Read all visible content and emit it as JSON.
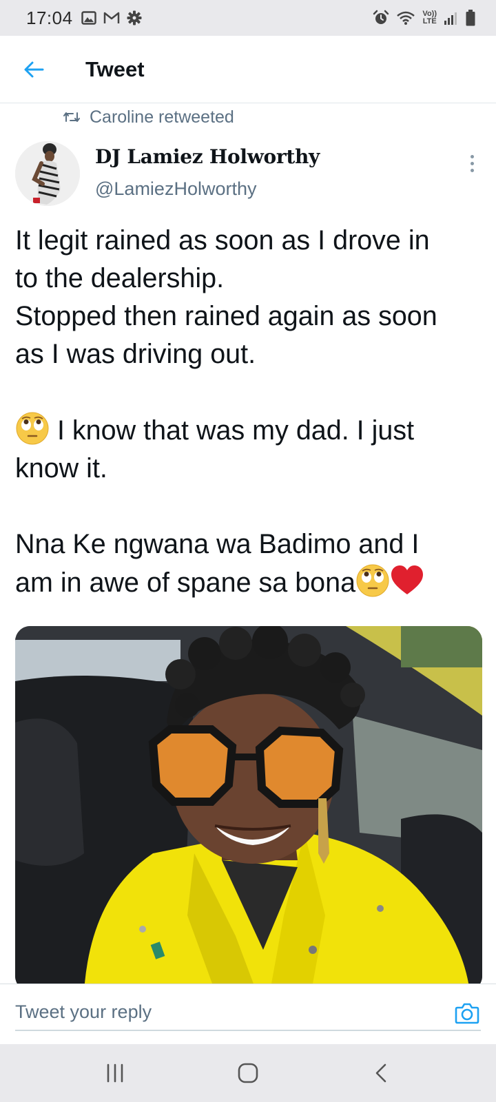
{
  "status_bar": {
    "time": "17:04",
    "left_icons": [
      "gallery-icon",
      "gmail-icon",
      "settings-gear-icon"
    ],
    "right_icons": [
      "alarm-icon",
      "wifi-icon",
      "volte-icon",
      "signal-icon",
      "battery-icon"
    ],
    "volte_label_top": "Vo))",
    "volte_label_bottom": "LTE"
  },
  "app_bar": {
    "back_icon": "arrow-left-icon",
    "title": "Tweet",
    "accent_color": "#1da1f2"
  },
  "tweet": {
    "retweet_icon": "retweet-icon",
    "retweeted_by": "Caroline retweeted",
    "author": {
      "display_name": "DJ Lamiez Holworthy",
      "handle": "@LamiezHolworthy"
    },
    "more_icon": "more-vertical-icon",
    "text_lines": {
      "p1_l1": "It legit rained as soon as I drove in",
      "p1_l2": "to the dealership.",
      "p1_l3": "Stopped then rained again as soon",
      "p1_l4": "as I was driving out.",
      "p2_l1": " I know that was my dad. I just",
      "p2_l2": "know it.",
      "p3_l1": "Nna Ke ngwana wa Badimo and I",
      "p3_l2": "am in awe of spane sa bona"
    },
    "emojis": [
      "face-with-rolling-eyes-emoji",
      "red-heart-emoji"
    ],
    "media_type": "photo"
  },
  "reply_bar": {
    "placeholder": "Tweet your reply",
    "camera_icon": "camera-icon"
  },
  "nav_bar": {
    "icons": [
      "recent-apps-icon",
      "home-icon",
      "back-icon"
    ]
  },
  "colors": {
    "text_primary": "#0f1419",
    "text_secondary": "#5b7083",
    "accent": "#1da1f2",
    "heart": "#e0202e",
    "system_bar": "#e9e9ec"
  }
}
